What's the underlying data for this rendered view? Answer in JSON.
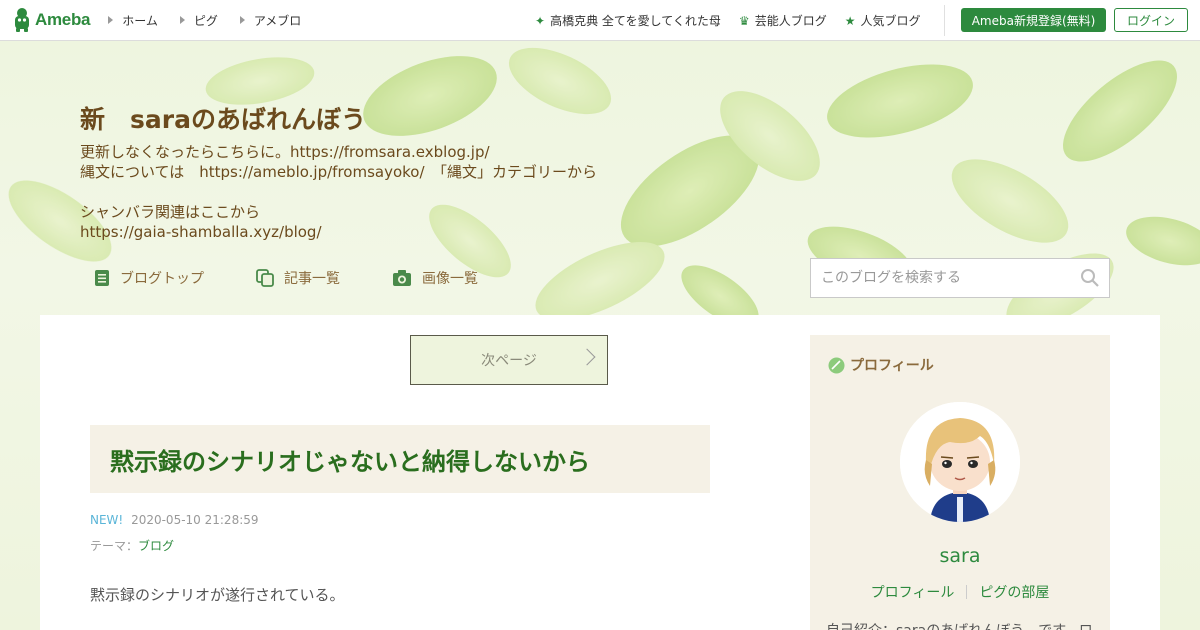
{
  "topbar": {
    "logo_text": "Ameba",
    "nav_left": [
      "ホーム",
      "ピグ",
      "アメブロ"
    ],
    "nav_right": [
      {
        "icon": "sparkle-icon",
        "label": "高橋克典 全てを愛してくれた母"
      },
      {
        "icon": "crown-icon",
        "label": "芸能人ブログ"
      },
      {
        "icon": "star-icon",
        "label": "人気ブログ"
      }
    ],
    "register_label": "Ameba新規登録(無料)",
    "login_label": "ログイン"
  },
  "blog": {
    "title": "新　saraのあばれんぼう",
    "description_lines": [
      "更新しなくなったらこちらに。https://fromsara.exblog.jp/",
      "縄文については　https://ameblo.jp/fromsayoko/　「縄文」カテゴリーから",
      "",
      "シャンバラ関連はここから",
      "https://gaia-shamballa.xyz/blog/"
    ],
    "nav": [
      {
        "icon": "document-icon",
        "label": "ブログトップ"
      },
      {
        "icon": "copy-icon",
        "label": "記事一覧"
      },
      {
        "icon": "camera-icon",
        "label": "画像一覧"
      }
    ],
    "search_placeholder": "このブログを検索する"
  },
  "pagination": {
    "next_label": "次ページ"
  },
  "entry": {
    "title": "黙示録のシナリオじゃないと納得しないから",
    "new_badge": "NEW!",
    "datetime": "2020-05-10 21:28:59",
    "theme_label": "テーマ：",
    "theme": "ブログ",
    "body_first_line": "黙示録のシナリオが遂行されている。"
  },
  "profile": {
    "heading": "プロフィール",
    "name": "sara",
    "links": [
      "プロフィール",
      "ピグの部屋"
    ],
    "intro": "自己紹介：saraのあばれんぼう　です。ロ"
  },
  "colors": {
    "brand_green": "#2d8a3e",
    "title_brown": "#6b4a1d",
    "entry_title_green": "#2a6e1e"
  }
}
